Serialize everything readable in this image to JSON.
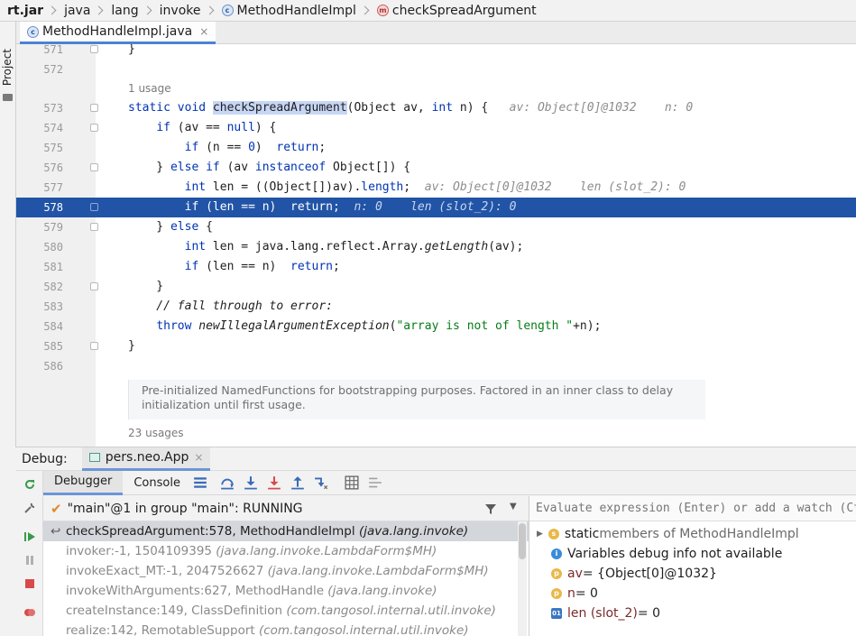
{
  "breadcrumb": {
    "items": [
      "rt.jar",
      "java",
      "lang",
      "invoke",
      "MethodHandleImpl",
      "checkSpreadArgument"
    ]
  },
  "left_strip": {
    "project_label": "Project"
  },
  "editor_tab": {
    "label": "MethodHandleImpl.java",
    "close": "×"
  },
  "editor": {
    "lines": [
      {
        "num": "571",
        "code": "}"
      },
      {
        "num": "572",
        "code": ""
      },
      {
        "num": "573",
        "code": "static void checkSpreadArgument(Object av, int n) {",
        "hint": "av: Object[0]@1032    n: 0"
      },
      {
        "num": "574",
        "code": "    if (av == null) {"
      },
      {
        "num": "575",
        "code": "        if (n == 0)  return;"
      },
      {
        "num": "576",
        "code": "    } else if (av instanceof Object[]) {"
      },
      {
        "num": "577",
        "code": "        int len = ((Object[])av).length;",
        "hint": "av: Object[0]@1032    len (slot_2): 0"
      },
      {
        "num": "578",
        "code": "        if (len == n)  return;",
        "hint": "n: 0    len (slot_2): 0"
      },
      {
        "num": "579",
        "code": "    } else {"
      },
      {
        "num": "580",
        "code": "        int len = java.lang.reflect.Array.getLength(av);"
      },
      {
        "num": "581",
        "code": "        if (len == n)  return;"
      },
      {
        "num": "582",
        "code": "    }"
      },
      {
        "num": "583",
        "code": "    // fall through to error:"
      },
      {
        "num": "584",
        "code": "    throw newIllegalArgumentException(\"array is not of length \"+n);"
      },
      {
        "num": "585",
        "code": "}"
      },
      {
        "num": "586",
        "code": ""
      }
    ],
    "usage_top": "1 usage",
    "doc_text": "Pre-initialized NamedFunctions for bootstrapping purposes. Factored in an inner class to delay initialization until first usage.",
    "usage_bottom": "23 usages"
  },
  "debug": {
    "label": "Debug:",
    "app_tab": "pers.neo.App",
    "tabs": [
      "Debugger",
      "Console"
    ],
    "thread": "\"main\"@1 in group \"main\": RUNNING",
    "frames": [
      {
        "name": "checkSpreadArgument:578, MethodHandleImpl ",
        "pkg": "(java.lang.invoke)",
        "active": true
      },
      {
        "name": "invoker:-1, 1504109395 ",
        "pkg": "(java.lang.invoke.LambdaForm$MH)"
      },
      {
        "name": "invokeExact_MT:-1, 2047526627 ",
        "pkg": "(java.lang.invoke.LambdaForm$MH)"
      },
      {
        "name": "invokeWithArguments:627, MethodHandle ",
        "pkg": "(java.lang.invoke)"
      },
      {
        "name": "createInstance:149, ClassDefinition ",
        "pkg": "(com.tangosol.internal.util.invoke)"
      },
      {
        "name": "realize:142, RemotableSupport ",
        "pkg": "(com.tangosol.internal.util.invoke)"
      }
    ],
    "eval_placeholder": "Evaluate expression (Enter) or add a watch (Ctrl+Shift+Enter)",
    "vars": {
      "static_prefix": "static",
      "static_rest": " members of MethodHandleImpl",
      "info": "Variables debug info not available",
      "av_name": "av",
      "av_value": " = {Object[0]@1032}",
      "n_name": "n",
      "n_value": " = 0",
      "len_name": "len (slot_2)",
      "len_value": " = 0"
    }
  },
  "colors": {
    "exec_line": "#2154a6",
    "keyword": "#0033b3",
    "string": "#067d17",
    "selection": "#c7d6f5"
  }
}
